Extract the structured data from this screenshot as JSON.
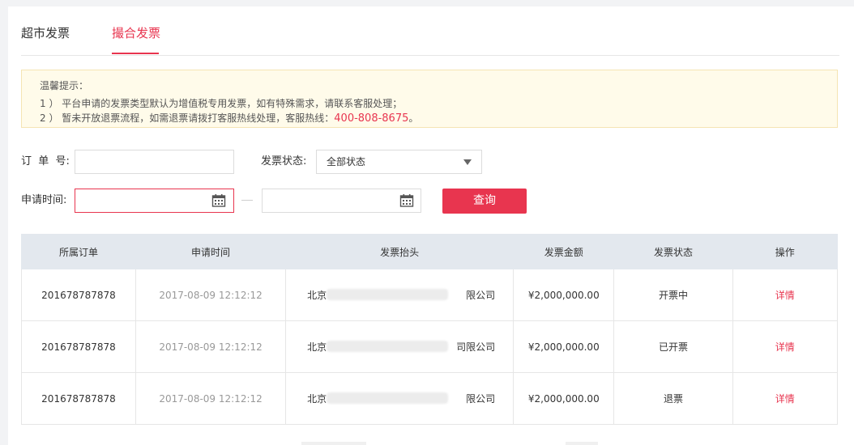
{
  "tabs": [
    {
      "label": "超市发票",
      "active": false
    },
    {
      "label": "撮合发票",
      "active": true
    }
  ],
  "notice": {
    "title": "温馨提示：",
    "line1": "1 ） 平台申请的发票类型默认为增值税专用发票，如有特殊需求，请联系客服处理；",
    "line2_prefix": "2 ） 暂未开放退票流程，如需退票请拨打客服热线处理，客服热线：",
    "hotline": "400-808-8675",
    "line2_suffix": "。"
  },
  "filters": {
    "order_label": "订  单  号:",
    "order_value": "",
    "status_label": "发票状态:",
    "status_selected": "全部状态",
    "time_label": "申请时间:",
    "start_date": "",
    "end_date": "",
    "query_label": "查询"
  },
  "table": {
    "headers": [
      "所属订单",
      "申请时间",
      "发票抬头",
      "发票金额",
      "发票状态",
      "操作"
    ],
    "rows": [
      {
        "order": "201678787878",
        "time": "2017-08-09 12:12:12",
        "title_prefix": "北京",
        "title_suffix": "限公司",
        "amount": "¥2,000,000.00",
        "status": "开票中",
        "action": "详情"
      },
      {
        "order": "201678787878",
        "time": "2017-08-09 12:12:12",
        "title_prefix": "北京",
        "title_suffix": "司限公司",
        "amount": "¥2,000,000.00",
        "status": "已开票",
        "action": "详情"
      },
      {
        "order": "201678787878",
        "time": "2017-08-09 12:12:12",
        "title_prefix": "北京",
        "title_suffix": "限公司",
        "amount": "¥2,000,000.00",
        "status": "退票",
        "action": "详情"
      }
    ]
  },
  "colors": {
    "accent": "#e8354f",
    "notice_bg": "#fffbea",
    "header_bg": "#e3e8ee"
  },
  "icons": {
    "calendar": "calendar-icon",
    "dropdown": "chevron-down-icon"
  }
}
